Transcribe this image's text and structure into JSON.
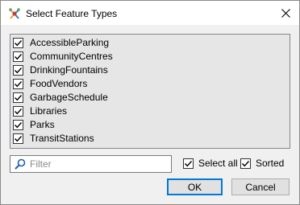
{
  "dialog": {
    "title": "Select Feature Types",
    "app_icon": "fme-workbench-icon",
    "close_icon": "close-icon"
  },
  "feature_types": [
    {
      "label": "AccessibleParking",
      "checked": true
    },
    {
      "label": "CommunityCentres",
      "checked": true
    },
    {
      "label": "DrinkingFountains",
      "checked": true
    },
    {
      "label": "FoodVendors",
      "checked": true
    },
    {
      "label": "GarbageSchedule",
      "checked": true
    },
    {
      "label": "Libraries",
      "checked": true
    },
    {
      "label": "Parks",
      "checked": true
    },
    {
      "label": "TransitStations",
      "checked": true
    }
  ],
  "filter": {
    "placeholder": "Filter",
    "value": "",
    "icon": "search-icon"
  },
  "options": {
    "select_all_label": "Select all",
    "select_all_checked": true,
    "sorted_label": "Sorted",
    "sorted_checked": true
  },
  "buttons": {
    "ok_label": "OK",
    "cancel_label": "Cancel"
  },
  "colors": {
    "accent": "#0078d7",
    "list_background": "#e6e6e6"
  }
}
